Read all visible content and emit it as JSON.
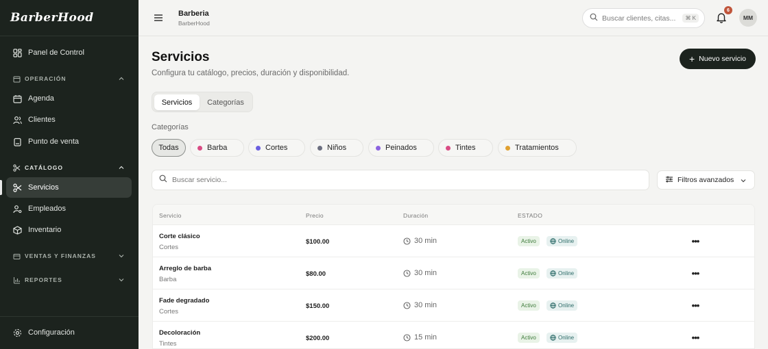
{
  "brand": {
    "logo": "BarberHood"
  },
  "sidebar": {
    "dashboard": "Panel de Control",
    "sections": {
      "operacion": "OPERACIÓN",
      "catalogo": "CATÁLOGO",
      "ventas": "VENTAS Y FINANZAS",
      "reportes": "REPORTES"
    },
    "items": {
      "agenda": "Agenda",
      "clientes": "Clientes",
      "punto_venta": "Punto de venta",
      "servicios": "Servicios",
      "empleados": "Empleados",
      "inventario": "Inventario"
    },
    "settings": "Configuración"
  },
  "topbar": {
    "business_name": "Barberia",
    "business_sub": "BarberHood",
    "search_placeholder": "Buscar clientes, citas...",
    "search_shortcut": "⌘ K",
    "notifications_count": "6",
    "avatar_initials": "MM"
  },
  "page": {
    "title": "Servicios",
    "subtitle": "Configura tu catálogo, precios, duración y disponibilidad.",
    "new_button": "Nuevo servicio"
  },
  "tabs": [
    "Servicios",
    "Categorías"
  ],
  "categories": {
    "label": "Categorías",
    "chips": [
      {
        "label": "Todas",
        "color": ""
      },
      {
        "label": "Barba",
        "color": "#d94c84"
      },
      {
        "label": "Cortes",
        "color": "#6b5fe0"
      },
      {
        "label": "Niños",
        "color": "#6c6f80"
      },
      {
        "label": "Peinados",
        "color": "#8c63e0"
      },
      {
        "label": "Tintes",
        "color": "#d94c84"
      },
      {
        "label": "Tratamientos",
        "color": "#e0a030"
      }
    ]
  },
  "filters": {
    "search_placeholder": "Buscar servicio...",
    "advanced": "Filtros avanzados"
  },
  "table": {
    "headers": {
      "service": "Servicio",
      "price": "Precio",
      "duration": "Duración",
      "status": "ESTADO"
    },
    "rows": [
      {
        "name": "Corte clásico",
        "category": "Cortes",
        "price": "$100.00",
        "duration": "30 min",
        "status": "Activo",
        "channel": "Online"
      },
      {
        "name": "Arreglo de barba",
        "category": "Barba",
        "price": "$80.00",
        "duration": "30 min",
        "status": "Activo",
        "channel": "Online"
      },
      {
        "name": "Fade degradado",
        "category": "Cortes",
        "price": "$150.00",
        "duration": "30 min",
        "status": "Activo",
        "channel": "Online"
      },
      {
        "name": "Decoloración",
        "category": "Tintes",
        "price": "$200.00",
        "duration": "15 min",
        "status": "Activo",
        "channel": "Online"
      }
    ]
  }
}
